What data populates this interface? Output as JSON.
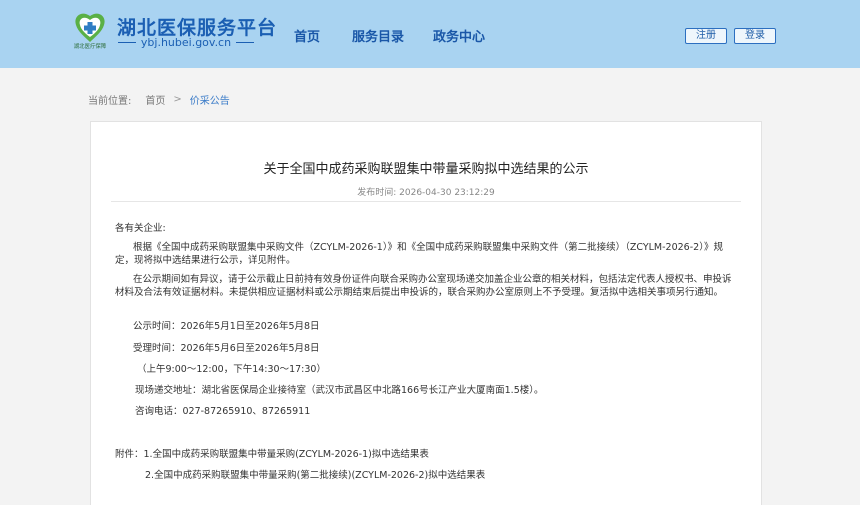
{
  "header": {
    "logo_sub": "湖北医疗保障",
    "site_title": "湖北医保服务平台",
    "site_domain": "ybj.hubei.gov.cn",
    "nav": [
      "首页",
      "服务目录",
      "政务中心"
    ],
    "register_label": "注册",
    "login_label": "登录",
    "colors": {
      "bar": "#a9d3f1",
      "brand": "#1b5fb3",
      "logo_green": "#5ab046"
    }
  },
  "breadcrumb": {
    "label": "当前位置:",
    "home": "首页",
    "separator": ">",
    "current": "价采公告"
  },
  "article": {
    "title": "关于全国中成药采购联盟集中带量采购拟中选结果的公示",
    "publish_label": "发布时间:",
    "publish_time": "2026-04-30 23:12:29",
    "salutation": "各有关企业:",
    "para1": "根据《全国中成药采购联盟集中采购文件（ZCYLM-2026-1）》和《全国中成药采购联盟集中采购文件（第二批接续）（ZCYLM-2026-2）》规定，现将拟中选结果进行公示，详见附件。",
    "para2": "在公示期间如有异议，请于公示截止日前持有效身份证件向联合采购办公室现场递交加盖企业公章的相关材料，包括法定代表人授权书、申投诉材料及合法有效证据材料。未提供相应证据材料或公示期结束后提出申投诉的，联合采购办公室原则上不予受理。复活拟中选相关事项另行通知。",
    "notice_period": "公示时间：2026年5月1日至2026年5月8日",
    "accept_period": "受理时间：2026年5月6日至2026年5月8日",
    "accept_hours": "（上午9:00～12:00，下午14:30～17:30）",
    "address": "现场递交地址：湖北省医保局企业接待室（武汉市武昌区中北路166号长江产业大厦南面1.5楼）。",
    "phone": "咨询电话：027-87265910、87265911",
    "attach_label": "附件：",
    "attachments": [
      "1.全国中成药采购联盟集中带量采购(ZCYLM-2026-1)拟中选结果表",
      "2.全国中成药采购联盟集中带量采购(第二批接续)(ZCYLM-2026-2)拟中选结果表"
    ]
  }
}
